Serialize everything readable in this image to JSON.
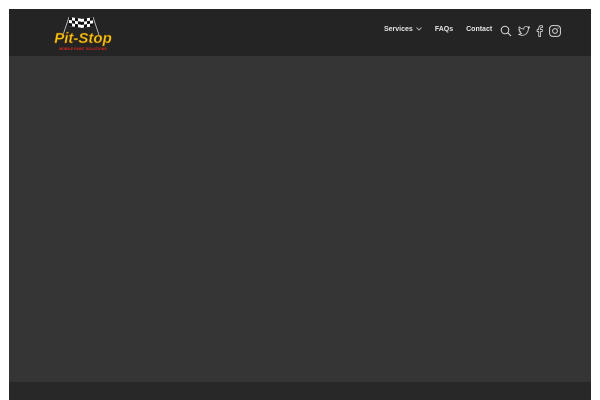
{
  "brand": {
    "name": "Pit-Stop",
    "tagline": "MOBILE PAINT SOLUTIONS",
    "logo_color": "#f5c518",
    "tagline_color": "#d9261c"
  },
  "nav": {
    "items": [
      {
        "label": "Services",
        "has_dropdown": true
      },
      {
        "label": "FAQs"
      },
      {
        "label": "Contact"
      }
    ]
  },
  "header_icons": [
    "search-icon",
    "twitter-icon",
    "facebook-icon",
    "instagram-icon"
  ],
  "colors": {
    "header_bg": "#242424",
    "main_bg": "#353535",
    "footer_bg": "#282828",
    "nav_text": "#e6e6e6"
  }
}
